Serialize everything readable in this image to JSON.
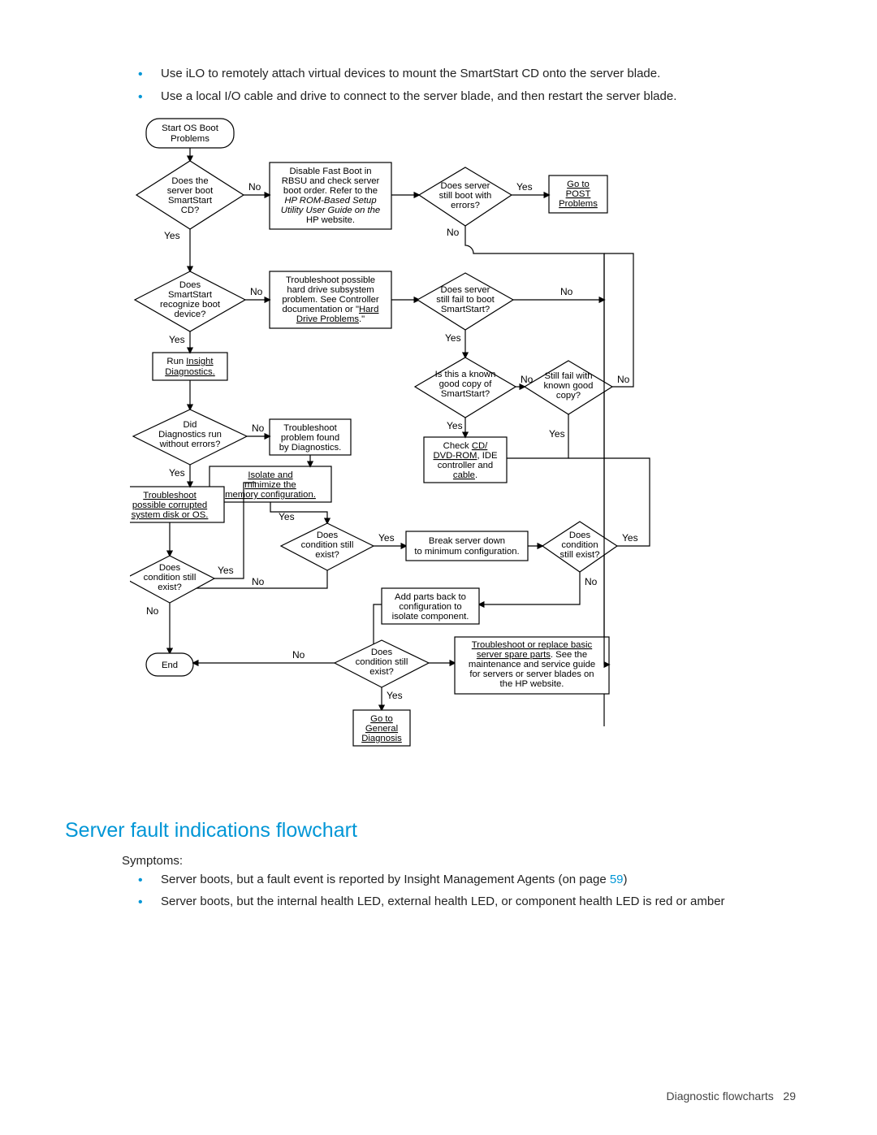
{
  "bullets_top": [
    "Use iLO to remotely attach virtual devices to mount the SmartStart CD onto the server blade.",
    "Use a local I/O cable and drive to connect to the server blade, and then restart the server blade."
  ],
  "section_heading": "Server fault indications flowchart",
  "symptoms_label": "Symptoms:",
  "symptoms_bullets": [
    {
      "pre": "Server boots, but a fault event is reported by Insight Management Agents (on page ",
      "link": "59",
      "post": ")"
    },
    {
      "pre": "Server boots, but the internal health LED, external health LED, or component health LED is red or amber",
      "link": "",
      "post": ""
    }
  ],
  "footer_section": "Diagnostic flowcharts",
  "footer_page": "29",
  "chart": {
    "start": [
      "Start OS Boot",
      "Problems"
    ],
    "d_boot_cd": [
      "Does the",
      "server boot",
      "SmartStart",
      "CD?"
    ],
    "rbsu": [
      "Disable Fast Boot in",
      "RBSU and check server",
      "boot order. Refer to the",
      "HP ROM-Based Setup",
      "Utility User Guide on the",
      "HP website."
    ],
    "d_errors": [
      "Does server",
      "still boot with",
      "errors?"
    ],
    "post_link": [
      "Go to",
      "POST",
      "Problems"
    ],
    "d_recognize": [
      "Does",
      "SmartStart",
      "recognize boot",
      "device?"
    ],
    "hdd": [
      "Troubleshoot possible",
      "hard drive subsystem",
      "problem. See Controller",
      "documentation or \"Hard",
      "Drive Problems.\""
    ],
    "d_fail_ss": [
      "Does server",
      "still fail to boot",
      "SmartStart?"
    ],
    "run_diag": [
      "Run Insight",
      "Diagnostics."
    ],
    "d_known": [
      "Is this a known",
      "good copy of",
      "SmartStart?"
    ],
    "d_still_fail": [
      "Still fail with",
      "known good",
      "copy?"
    ],
    "d_diag_ok": [
      "Did",
      "Diagnostics run",
      "without errors?"
    ],
    "ts_diag": [
      "Troubleshoot",
      "problem found",
      "by Diagnostics."
    ],
    "check_cd": [
      "Check CD/",
      "DVD-ROM, IDE",
      "controller and",
      "cable."
    ],
    "isolate_mem": [
      "Isolate and",
      "minimize the",
      "memory configuration."
    ],
    "ts_os": [
      "Troubleshoot",
      "possible corrupted",
      "system disk or OS."
    ],
    "d_cond1": [
      "Does",
      "condition still",
      "exist?"
    ],
    "break_min": [
      "Break server down",
      "to minimum configuration."
    ],
    "d_cond_right": [
      "Does",
      "condition",
      "still exist?"
    ],
    "d_cond_left": [
      "Does",
      "condition still",
      "exist?"
    ],
    "add_parts": [
      "Add parts back to",
      "configuration to",
      "isolate component."
    ],
    "end": "End",
    "d_cond_final": [
      "Does",
      "condition still",
      "exist?"
    ],
    "spare": [
      "Troubleshoot or replace basic",
      "server spare parts. See the",
      "maintenance and service guide",
      "for servers or server blades on",
      "the HP website."
    ],
    "general": [
      "Go to",
      "General",
      "Diagnosis"
    ],
    "labels": {
      "yes": "Yes",
      "no": "No"
    }
  }
}
